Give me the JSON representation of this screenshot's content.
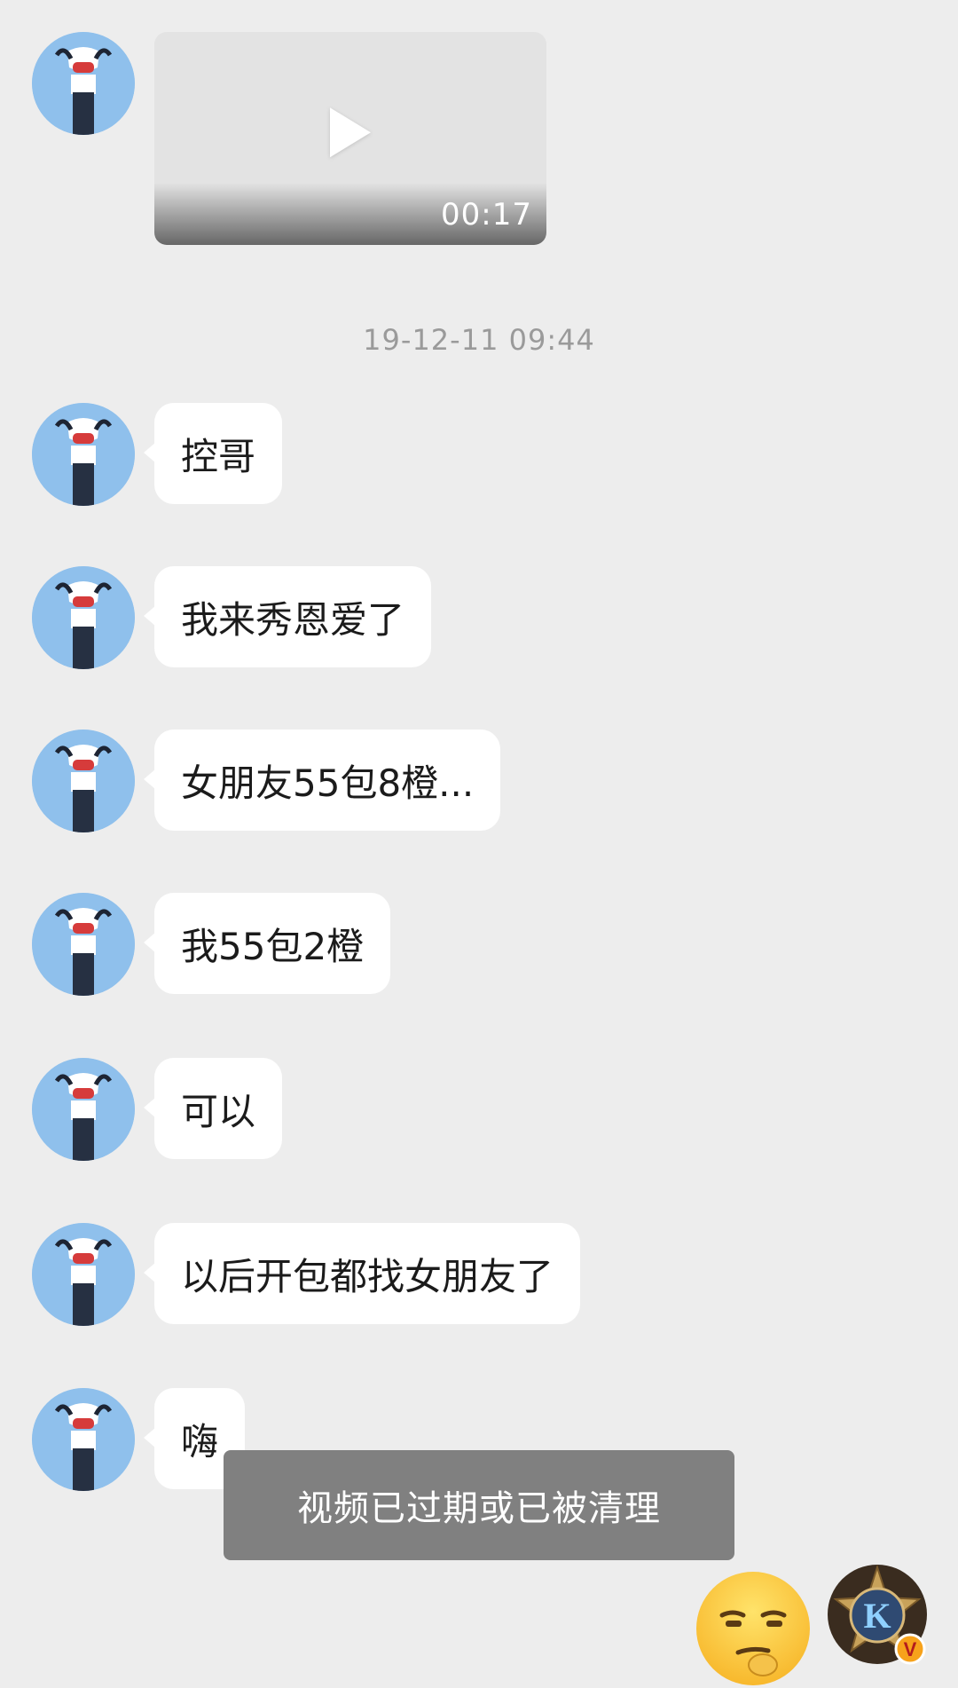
{
  "video": {
    "duration": "00:17",
    "icon": "play-icon"
  },
  "timestamp": "19-12-11 09:44",
  "messages": [
    {
      "text": "控哥"
    },
    {
      "text": "我来秀恩爱了"
    },
    {
      "text": "女朋友55包8橙..."
    },
    {
      "text": "我55包2橙"
    },
    {
      "text": "可以"
    },
    {
      "text": "以后开包都找女朋友了"
    },
    {
      "text": "嗨"
    }
  ],
  "toast": "视频已过期或已被清理",
  "colors": {
    "background": "#ededed",
    "bubble": "#ffffff",
    "toast": "#808080",
    "avatar_blue": "#9cc7ef"
  },
  "badge_avatar": {
    "letter": "K",
    "badge": "V"
  }
}
